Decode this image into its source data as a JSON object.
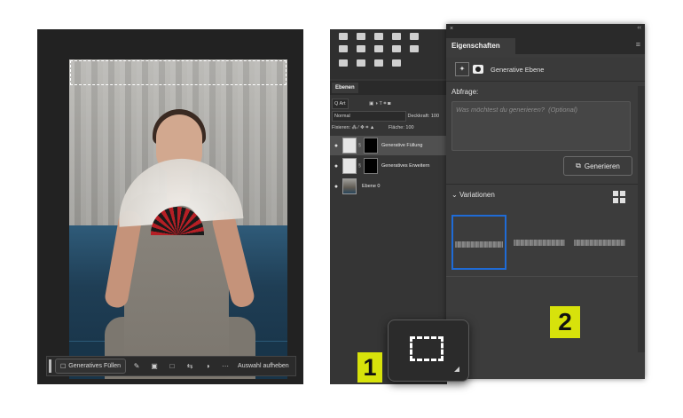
{
  "task_bar": {
    "generate_fill_label": "Generatives Füllen",
    "deselect_label": "Auswahl aufheben",
    "more_label": "···"
  },
  "layers_panel": {
    "tab_label": "Ebenen",
    "filter_kind": "Q Art",
    "blend_mode": "Normal",
    "opacity_label": "Deckkraft:",
    "opacity_value": "100",
    "lock_label": "Fixieren:",
    "fill_label": "Fläche:",
    "fill_value": "100",
    "layers": [
      {
        "name": "Generative Füllung"
      },
      {
        "name": "Generatives Erweitern"
      },
      {
        "name": "Ebene 0"
      }
    ]
  },
  "properties_panel": {
    "close_label": "×",
    "collapse_label": "‹‹",
    "tab_label": "Eigenschaften",
    "layer_type": "Generative Ebene",
    "prompt_label": "Abfrage:",
    "prompt_placeholder": "Was möchtest du generieren?  (Optional)",
    "generate_button": "Generieren",
    "variations_label": "Variationen"
  },
  "callouts": {
    "one": "1",
    "two": "2"
  },
  "colors": {
    "callout": "#d7e20b",
    "selection_highlight": "#1f6bd6",
    "panel_bg": "#3c3c3c"
  }
}
